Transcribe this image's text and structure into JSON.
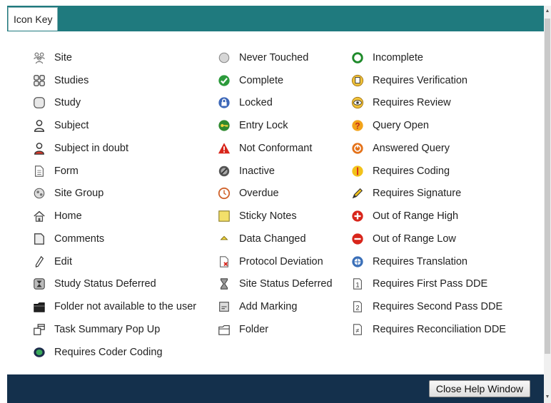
{
  "tab": {
    "label": "Icon Key"
  },
  "footer": {
    "close_button": "Close Help Window"
  },
  "colors": {
    "header": "#1f7a7e",
    "footer": "#14304c"
  },
  "columns": [
    [
      {
        "label": "Site",
        "icon": "people-group-icon"
      },
      {
        "label": "Studies",
        "icon": "studies-grid-icon"
      },
      {
        "label": "Study",
        "icon": "study-cylinder-icon"
      },
      {
        "label": "Subject",
        "icon": "subject-person-icon"
      },
      {
        "label": "Subject in doubt",
        "icon": "subject-doubt-icon"
      },
      {
        "label": "Form",
        "icon": "form-document-icon"
      },
      {
        "label": "Site Group",
        "icon": "site-group-icon"
      },
      {
        "label": "Home",
        "icon": "home-icon"
      },
      {
        "label": "Comments",
        "icon": "comments-icon"
      },
      {
        "label": "Edit",
        "icon": "pencil-icon"
      },
      {
        "label": "Study Status Deferred",
        "icon": "hourglass-box-icon"
      },
      {
        "label": "Folder not available to the user",
        "icon": "folder-dark-icon"
      },
      {
        "label": "Task Summary Pop Up",
        "icon": "popup-window-icon"
      },
      {
        "label": "Requires Coder Coding",
        "icon": "coder-coding-icon"
      }
    ],
    [
      {
        "label": "Never Touched",
        "icon": "grey-circle-icon"
      },
      {
        "label": "Complete",
        "icon": "check-circle-icon"
      },
      {
        "label": "Locked",
        "icon": "lock-icon"
      },
      {
        "label": "Entry Lock",
        "icon": "key-circle-icon"
      },
      {
        "label": "Not Conformant",
        "icon": "warning-triangle-icon"
      },
      {
        "label": "Inactive",
        "icon": "inactive-icon"
      },
      {
        "label": "Overdue",
        "icon": "clock-icon"
      },
      {
        "label": "Sticky Notes",
        "icon": "sticky-note-icon"
      },
      {
        "label": "Data Changed",
        "icon": "triangle-up-icon"
      },
      {
        "label": "Protocol Deviation",
        "icon": "protocol-deviation-icon"
      },
      {
        "label": "Site Status Deferred",
        "icon": "hourglass-icon"
      },
      {
        "label": "Add Marking",
        "icon": "add-marking-icon"
      },
      {
        "label": "Folder",
        "icon": "folder-icon"
      }
    ],
    [
      {
        "label": "Incomplete",
        "icon": "green-ring-icon"
      },
      {
        "label": "Requires Verification",
        "icon": "verification-icon"
      },
      {
        "label": "Requires Review",
        "icon": "eye-icon"
      },
      {
        "label": "Query Open",
        "icon": "question-icon"
      },
      {
        "label": "Answered Query",
        "icon": "answered-query-icon"
      },
      {
        "label": "Requires Coding",
        "icon": "coding-icon"
      },
      {
        "label": "Requires Signature",
        "icon": "signature-pen-icon"
      },
      {
        "label": "Out of Range High",
        "icon": "plus-circle-icon"
      },
      {
        "label": "Out of Range Low",
        "icon": "minus-circle-icon"
      },
      {
        "label": "Requires Translation",
        "icon": "translation-icon"
      },
      {
        "label": "Requires First Pass DDE",
        "icon": "dde-first-icon"
      },
      {
        "label": "Requires Second Pass DDE",
        "icon": "dde-second-icon"
      },
      {
        "label": "Requires Reconciliation DDE",
        "icon": "dde-reconciliation-icon"
      }
    ]
  ]
}
